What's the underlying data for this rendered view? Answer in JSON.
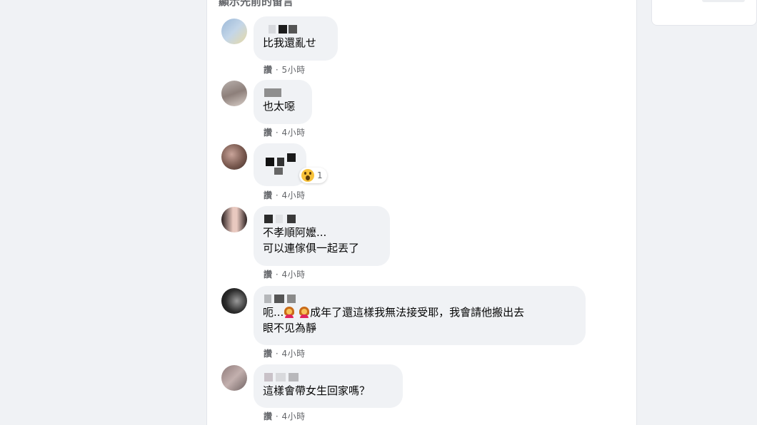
{
  "section": {
    "prev_comments_label": "顯示先前的留言"
  },
  "colors": {
    "bubble_bg": "#f0f2f5",
    "text": "#050505",
    "meta": "#65676b",
    "page_bg": "#f0f2f5"
  },
  "comments": [
    {
      "text": "比我還亂せ",
      "like_label": "讚",
      "separator": "·",
      "time": "5小時"
    },
    {
      "text": "也太噁",
      "like_label": "讚",
      "separator": "·",
      "time": "4小時"
    },
    {
      "text": "",
      "like_label": "讚",
      "separator": "·",
      "time": "4小時",
      "reaction": {
        "icon": "wow-reaction-icon",
        "count": "1"
      }
    },
    {
      "text": "不孝順阿嬤...\n可以連傢俱一起丟了",
      "like_label": "讚",
      "separator": "·",
      "time": "4小時"
    },
    {
      "text_before": "呃...",
      "emoji": "woman-emoji-icon",
      "text_after": "成年了還這樣我無法接受耶，我會請他搬出去\n眼不见為靜",
      "like_label": "讚",
      "separator": "·",
      "time": "4小時"
    },
    {
      "text": "這樣會帶女生回家嗎？",
      "like_label": "讚",
      "separator": "·",
      "time": "4小時"
    }
  ]
}
